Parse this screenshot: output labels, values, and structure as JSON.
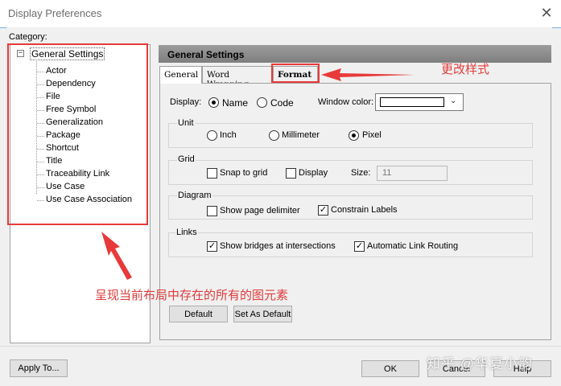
{
  "window": {
    "title": "Display Preferences"
  },
  "category": {
    "label": "Category:",
    "root": "General Settings",
    "root_toggle": "−",
    "items": [
      "Actor",
      "Dependency",
      "File",
      "Free Symbol",
      "Generalization",
      "Package",
      "Shortcut",
      "Title",
      "Traceability Link",
      "Use Case",
      "Use Case Association"
    ]
  },
  "panel": {
    "header": "General Settings"
  },
  "tabs": [
    {
      "label": "General"
    },
    {
      "label": "Word Wrapping"
    },
    {
      "label": "Format"
    }
  ],
  "display": {
    "label": "Display:",
    "name_option": "Name",
    "code_option": "Code",
    "selected": "Name",
    "window_color_label": "Window color:",
    "window_color": "#ffffff"
  },
  "unit": {
    "label": "Unit",
    "options": [
      "Inch",
      "Millimeter",
      "Pixel"
    ],
    "selected": "Pixel"
  },
  "grid": {
    "label": "Grid",
    "snap_label": "Snap to grid",
    "snap_checked": false,
    "display_label": "Display",
    "display_checked": false,
    "size_label": "Size:",
    "size_value": "11"
  },
  "diagram": {
    "label": "Diagram",
    "page_delimiter_label": "Show page delimiter",
    "page_delimiter_checked": false,
    "constrain_label": "Constrain Labels",
    "constrain_checked": true
  },
  "links": {
    "label": "Links",
    "bridges_label": "Show bridges at intersections",
    "bridges_checked": true,
    "routing_label": "Automatic Link Routing",
    "routing_checked": true
  },
  "buttons": {
    "default": "Default",
    "set_as_default": "Set As Default",
    "apply_to": "Apply To...",
    "ok": "OK",
    "cancel": "Cancel",
    "help": "Help"
  },
  "annotations": {
    "format_note": "更改样式",
    "tree_note": "呈现当前布局中存在的所有的图元素"
  },
  "watermark": "知乎 @华夏小韵",
  "colors": {
    "annotation": "#e83a3a",
    "header": "#8c8c8c"
  }
}
